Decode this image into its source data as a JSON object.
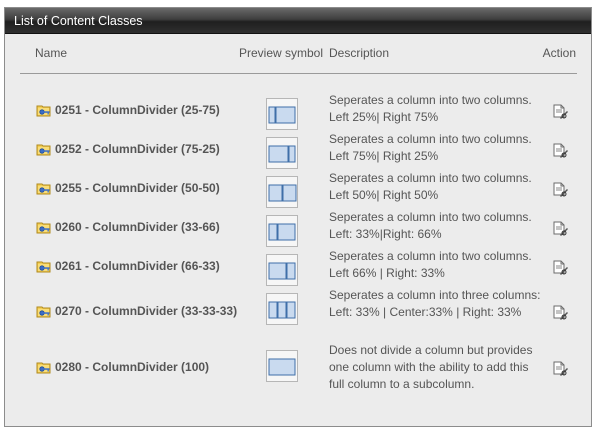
{
  "panel": {
    "title": "List of Content Classes"
  },
  "columns": {
    "name": "Name",
    "preview": "Preview symbol",
    "description": "Description",
    "action": "Action"
  },
  "icons": {
    "row_icon": "folder-key-icon",
    "action_icon": "edit-page-icon",
    "preview_icon": "column-layout-preview-icon"
  },
  "colors": {
    "header_bar": "#2f2f2f",
    "layout_fill": "#c9daef",
    "layout_border": "#3f6fa8"
  },
  "rows": [
    {
      "name": "0251 - ColumnDivider (25-75)",
      "layout": [
        25,
        75
      ],
      "description": "Seperates a column into two columns. Left 25%| Right 75%"
    },
    {
      "name": "0252 - ColumnDivider (75-25)",
      "layout": [
        75,
        25
      ],
      "description": "Seperates a column into two columns. Left 75%| Right 25%"
    },
    {
      "name": "0255 - ColumnDivider (50-50)",
      "layout": [
        50,
        50
      ],
      "description": "Seperates a column into two columns. Left 50%| Right 50%"
    },
    {
      "name": "0260 - ColumnDivider (33-66)",
      "layout": [
        33,
        66
      ],
      "description": "Seperates a column into two columns. Left: 33%|Right: 66%"
    },
    {
      "name": "0261 - ColumnDivider (66-33)",
      "layout": [
        66,
        33
      ],
      "description": "Seperates a column into two columns. Left 66% | Right: 33%"
    },
    {
      "name": "0270 - ColumnDivider (33-33-33)",
      "layout": [
        33,
        33,
        33
      ],
      "description": "Seperates a column into three columns: Left: 33% | Center:33% | Right: 33%"
    },
    {
      "name": "0280 - ColumnDivider (100)",
      "layout": [
        100
      ],
      "description": "Does not divide a column but provides one column with the ability to add this full column to a subcolumn."
    }
  ]
}
